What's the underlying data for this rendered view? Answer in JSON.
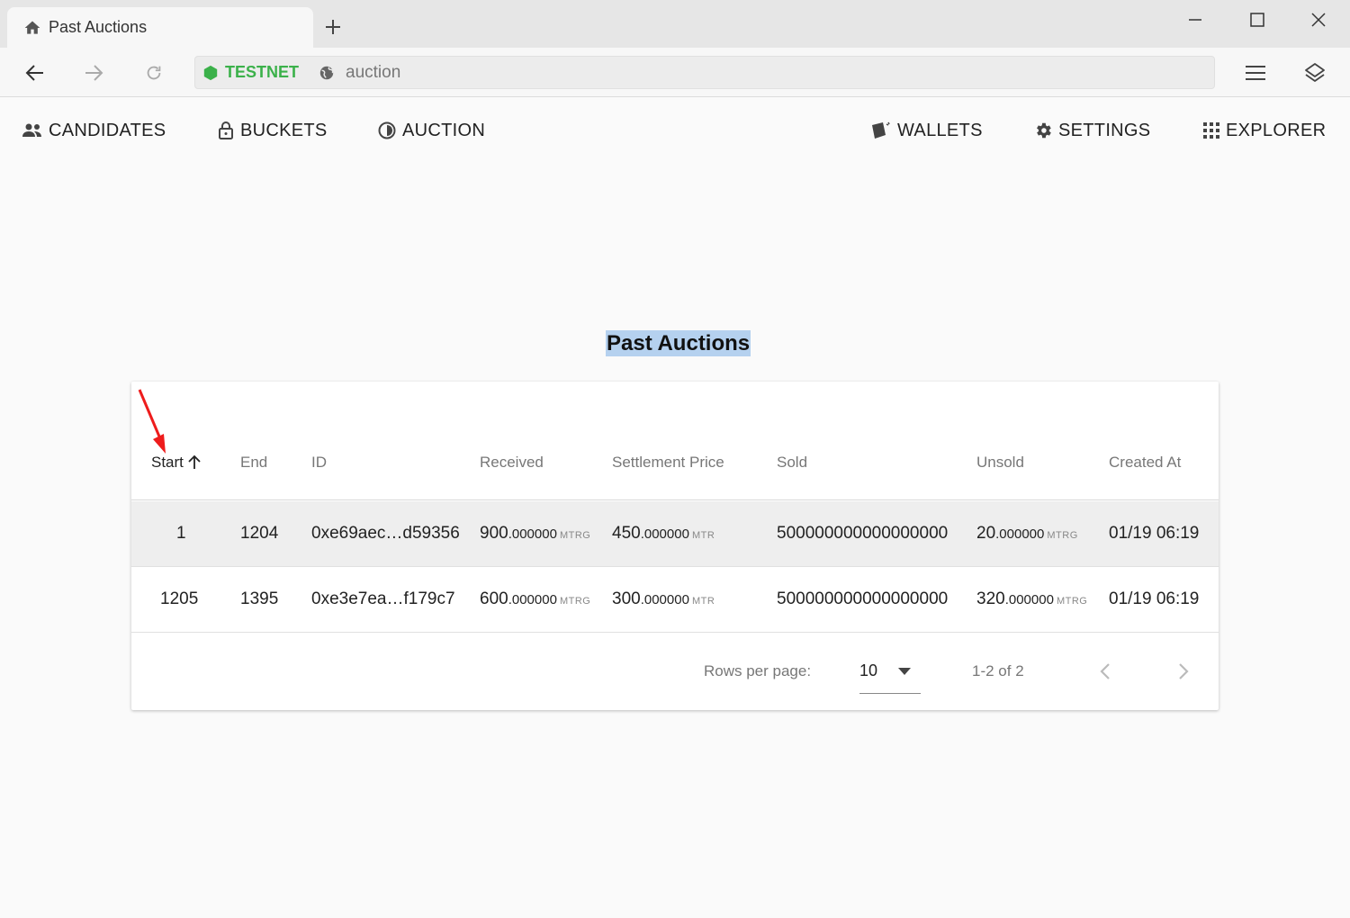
{
  "browser": {
    "tab_title": "Past Auctions",
    "network_label": "TESTNET",
    "url": "auction"
  },
  "nav": {
    "candidates": "CANDIDATES",
    "buckets": "BUCKETS",
    "auction": "AUCTION",
    "wallets": "WALLETS",
    "settings": "SETTINGS",
    "explorer": "EXPLORER"
  },
  "page": {
    "title": "Past Auctions"
  },
  "table": {
    "headers": {
      "start": "Start",
      "end": "End",
      "id": "ID",
      "received": "Received",
      "settlement_price": "Settlement Price",
      "sold": "Sold",
      "unsold": "Unsold",
      "created_at": "Created At"
    },
    "sort": {
      "column": "Start",
      "direction": "ascending"
    },
    "rows": [
      {
        "start": "1",
        "end": "1204",
        "id": "0xe69aec…d59356",
        "received_int": "900",
        "received_dec": ".000000",
        "received_unit": "MTRG",
        "price_int": "450",
        "price_dec": ".000000",
        "price_unit": "MTR",
        "sold": "500000000000000000",
        "unsold_int": "20",
        "unsold_dec": ".000000",
        "unsold_unit": "MTRG",
        "created_at": "01/19 06:19"
      },
      {
        "start": "1205",
        "end": "1395",
        "id": "0xe3e7ea…f179c7",
        "received_int": "600",
        "received_dec": ".000000",
        "received_unit": "MTRG",
        "price_int": "300",
        "price_dec": ".000000",
        "price_unit": "MTR",
        "sold": "500000000000000000",
        "unsold_int": "320",
        "unsold_dec": ".000000",
        "unsold_unit": "MTRG",
        "created_at": "01/19 06:19"
      }
    ]
  },
  "pagination": {
    "rows_per_page_label": "Rows per page:",
    "rows_per_page_value": "10",
    "range": "1-2 of 2"
  },
  "colors": {
    "testnet_green": "#3bb14a",
    "selection_highlight": "#b5d1ef",
    "annotation_arrow": "#ee1c1c"
  }
}
